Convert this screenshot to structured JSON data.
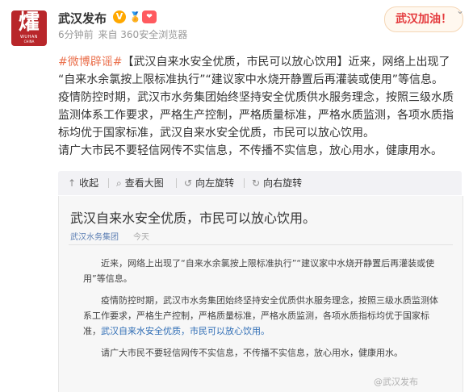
{
  "account": {
    "name": "武汉发布",
    "avatar_glyph": "㸌",
    "avatar_line1": "WUHAN",
    "avatar_line2": "CHINA",
    "vip_badge": "V",
    "red_badge": "❤"
  },
  "meta": {
    "time": "6分钟前",
    "source": "来自 360安全浏览器"
  },
  "card": {
    "label": "武汉加油！"
  },
  "post": {
    "hashtag": "#微博辟谣#",
    "text_lines": [
      "【武汉自来水安全优质，市民可以放心饮用】近来，网络上出现了",
      "“自来水余氯按上限标准执行”“建议家中水烧开静置后再灌装或使用”等信息。",
      "疫情防控时期，武汉市水务集团始终坚持安全优质供水服务理念，按照三级水质",
      "监测体系工作要求，严格生产控制，严格质量标准，严格水质监测，各项水质指",
      "标均优于国家标准，武汉自来水安全优质，市民可以放心饮用。",
      "请广大市民不要轻信网传不实信息，不传播不实信息，放心用水，健康用水。"
    ]
  },
  "toolbar": {
    "collapse": "收起",
    "view_large": "查看大图",
    "rotate_left": "向左旋转",
    "rotate_right": "向右旋转"
  },
  "image": {
    "title": "武汉自来水安全优质，市民可以放心饮用。",
    "source": "武汉水务集团",
    "date": "今天",
    "para1": "近来，网络上出现了“自来水余氯按上限标准执行”“建议家中水烧开静置后再灌装或使用”等信息。",
    "para2_prefix": "疫情防控时期，武汉市水务集团始终坚持安全优质供水服务理念，按照三级水质监测体系工作要求，严格生产控制，严格质量标准，严格水质监测，各项水质指标均优于国家标准，",
    "para2_link": "武汉自来水安全优质，市民可以放心饮用。",
    "para3": "请广大市民不要轻信网传不实信息，不传播不实信息，放心用水，健康用水。",
    "watermark": "@武汉发布"
  }
}
